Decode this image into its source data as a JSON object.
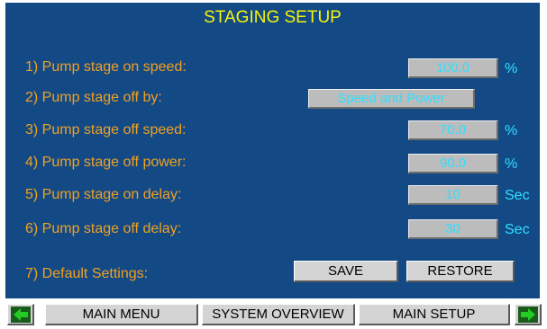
{
  "title": "STAGING SETUP",
  "rows": [
    {
      "label": "1) Pump stage on speed:",
      "value": "100.0",
      "unit": "%"
    },
    {
      "label": "2) Pump stage off by:",
      "value": "Speed and Power",
      "unit": ""
    },
    {
      "label": "3) Pump stage off speed:",
      "value": "70.0",
      "unit": "%"
    },
    {
      "label": "4) Pump stage off power:",
      "value": "90.0",
      "unit": "%"
    },
    {
      "label": "5) Pump stage on delay:",
      "value": "10",
      "unit": "Sec"
    },
    {
      "label": "6) Pump stage off delay:",
      "value": "30",
      "unit": "Sec"
    }
  ],
  "defaults": {
    "label": "7) Default Settings:",
    "save": "SAVE",
    "restore": "RESTORE"
  },
  "nav": {
    "back_icon": "arrow-left-icon",
    "main_menu": "MAIN MENU",
    "system_overview": "SYSTEM OVERVIEW",
    "main_setup": "MAIN SETUP",
    "forward_icon": "arrow-right-icon"
  },
  "colors": {
    "panel": "#134a86",
    "title": "#f4f40a",
    "label": "#f0a020",
    "value": "#2ee0ff",
    "arrow": "#22cc22"
  }
}
